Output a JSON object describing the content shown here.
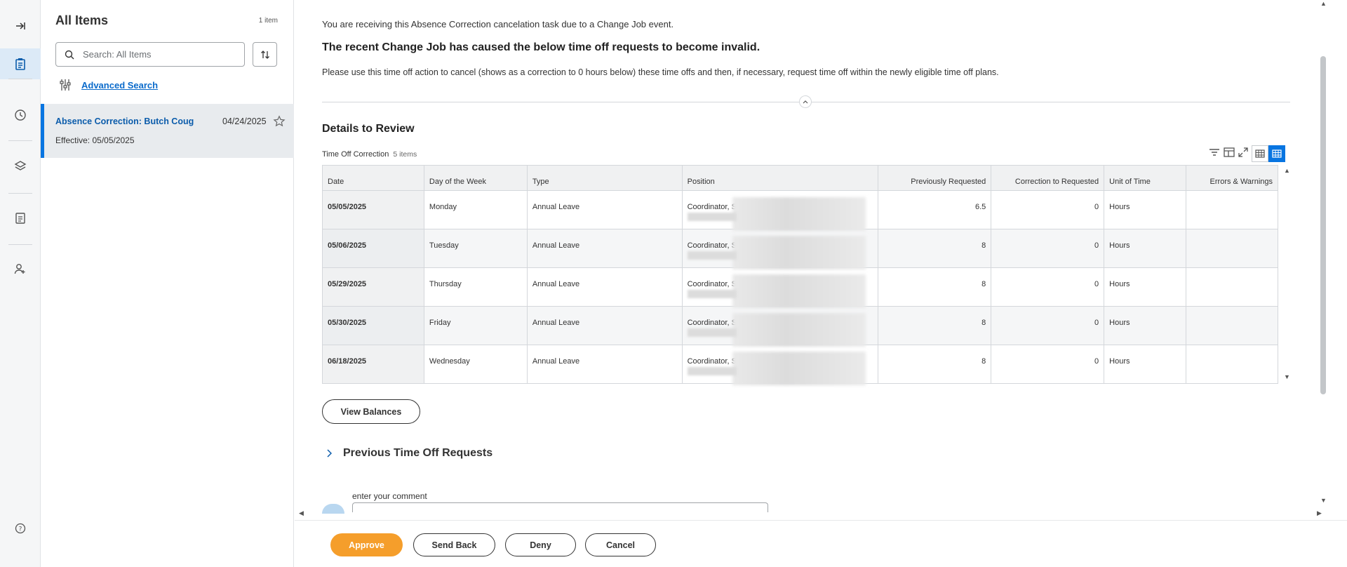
{
  "rail": {
    "items": [
      {
        "icon": "expand-panel-icon"
      },
      {
        "icon": "tasks-icon",
        "active": true
      },
      {
        "icon": "history-icon"
      },
      {
        "icon": "layers-icon"
      },
      {
        "icon": "clipboard-icon"
      },
      {
        "icon": "add-person-icon"
      },
      {
        "icon": "help-icon"
      }
    ]
  },
  "list": {
    "title": "All Items",
    "count": "1 item",
    "search_placeholder": "Search: All Items",
    "advanced_search": "Advanced Search",
    "items": [
      {
        "title": "Absence Correction: Butch Coug",
        "date": "04/24/2025",
        "effective": "Effective: 05/05/2025"
      }
    ]
  },
  "main": {
    "intro_line": "You are receiving this Absence Correction cancelation task due to a Change Job event.",
    "headline": "The recent Change Job has caused the below time off requests to become invalid.",
    "instructions": "Please use this time off action to cancel (shows as a correction to 0 hours below) these time offs and then, if necessary, request time off within the newly eligible time off plans.",
    "details_title": "Details to Review",
    "grid": {
      "title": "Time Off Correction",
      "count": "5 items",
      "columns": [
        "Date",
        "Day of the Week",
        "Type",
        "Position",
        "Previously Requested",
        "Correction to Requested",
        "Unit of Time",
        "Errors & Warnings"
      ],
      "rows": [
        {
          "date": "05/05/2025",
          "day": "Monday",
          "type": "Annual Leave",
          "position": "Coordinator, S",
          "prev": "6.5",
          "corr": "0",
          "unit": "Hours",
          "errors": ""
        },
        {
          "date": "05/06/2025",
          "day": "Tuesday",
          "type": "Annual Leave",
          "position": "Coordinator, S",
          "prev": "8",
          "corr": "0",
          "unit": "Hours",
          "errors": ""
        },
        {
          "date": "05/29/2025",
          "day": "Thursday",
          "type": "Annual Leave",
          "position": "Coordinator, S",
          "prev": "8",
          "corr": "0",
          "unit": "Hours",
          "errors": ""
        },
        {
          "date": "05/30/2025",
          "day": "Friday",
          "type": "Annual Leave",
          "position": "Coordinator, S",
          "prev": "8",
          "corr": "0",
          "unit": "Hours",
          "errors": ""
        },
        {
          "date": "06/18/2025",
          "day": "Wednesday",
          "type": "Annual Leave",
          "position": "Coordinator, S",
          "prev": "8",
          "corr": "0",
          "unit": "Hours",
          "errors": ""
        }
      ]
    },
    "view_balances": "View Balances",
    "previous_requests": "Previous Time Off Requests",
    "comment_label": "enter your comment"
  },
  "footer": {
    "approve": "Approve",
    "send_back": "Send Back",
    "deny": "Deny",
    "cancel": "Cancel"
  },
  "colors": {
    "accent": "#0875e1",
    "approve": "#f59e2b",
    "link": "#0b6bcb"
  }
}
